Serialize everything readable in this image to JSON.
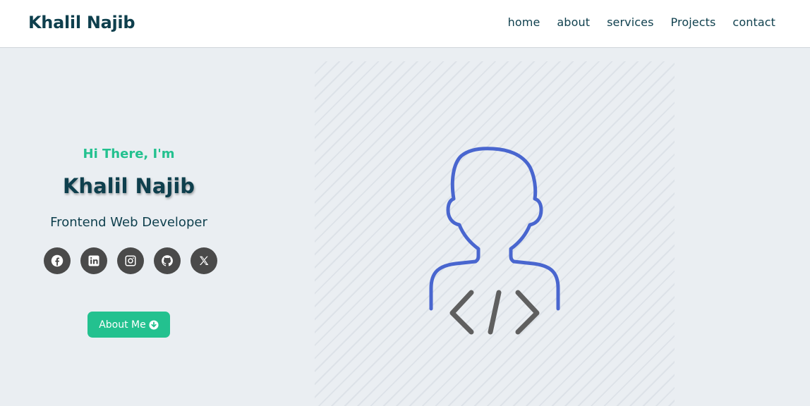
{
  "brand": {
    "name": "Khalil Najib"
  },
  "nav": {
    "links": [
      {
        "label": "home"
      },
      {
        "label": "about"
      },
      {
        "label": "services"
      },
      {
        "label": "Projects"
      },
      {
        "label": "contact"
      }
    ]
  },
  "hero": {
    "greeting": "Hi There, I'm",
    "name": "Khalil Najib",
    "role": "Frontend Web Developer",
    "socials": [
      {
        "icon": "facebook-icon"
      },
      {
        "icon": "linkedin-icon"
      },
      {
        "icon": "instagram-icon"
      },
      {
        "icon": "github-icon"
      },
      {
        "icon": "x-twitter-icon"
      }
    ],
    "cta": {
      "label": "About Me",
      "icon": "arrow-down-circle-icon"
    },
    "illustration": {
      "icon": "developer-avatar-code-icon"
    }
  },
  "colors": {
    "accent": "#23c18f",
    "heading": "#0e3f4d",
    "background": "#eaeef2",
    "social_bg": "#4a4a4a",
    "illustration_outline": "#4966cf",
    "code_symbol": "#5f5f5f"
  }
}
